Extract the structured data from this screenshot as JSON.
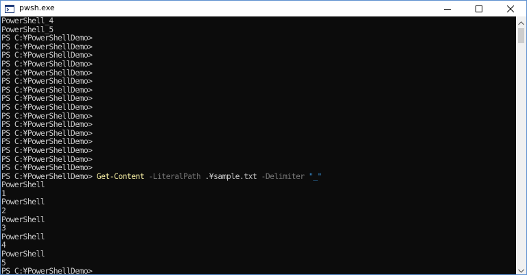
{
  "window": {
    "title": "pwsh.exe",
    "app_icon": "powershell-icon",
    "controls": {
      "minimize_icon": "minimize-icon",
      "maximize_icon": "maximize-icon",
      "close_icon": "close-icon"
    }
  },
  "console": {
    "colors": {
      "background": "#0c0c0c",
      "text": "#cccccc",
      "command": "#f9f1a5",
      "parameter": "#767676",
      "string": "#3a96dd"
    },
    "lines": [
      "PowerShell_4",
      "PowerShell_5",
      "PS C:¥PowerShellDemo>",
      "PS C:¥PowerShellDemo>",
      "PS C:¥PowerShellDemo>",
      "PS C:¥PowerShellDemo>",
      "PS C:¥PowerShellDemo>",
      "PS C:¥PowerShellDemo>",
      "PS C:¥PowerShellDemo>",
      "PS C:¥PowerShellDemo>",
      "PS C:¥PowerShellDemo>",
      "PS C:¥PowerShellDemo>",
      "PS C:¥PowerShellDemo>",
      "PS C:¥PowerShellDemo>",
      "PS C:¥PowerShellDemo>",
      "PS C:¥PowerShellDemo>",
      "PS C:¥PowerShellDemo>",
      "PS C:¥PowerShellDemo>"
    ],
    "command_line": {
      "prompt": "PS C:¥PowerShellDemo> ",
      "cmdlet": "Get-Content",
      "param1": " -LiteralPath",
      "arg1": " .¥sample.txt",
      "param2": " -Delimiter",
      "arg2": " \"_\""
    },
    "output_lines": [
      "PowerShell",
      "1",
      "PowerShell",
      "2",
      "PowerShell",
      "3",
      "PowerShell",
      "4",
      "PowerShell",
      "5",
      "PS C:¥PowerShellDemo>"
    ]
  },
  "scrollbar": {
    "up_icon": "scroll-up-arrow-icon",
    "down_icon": "scroll-down-arrow-icon"
  }
}
